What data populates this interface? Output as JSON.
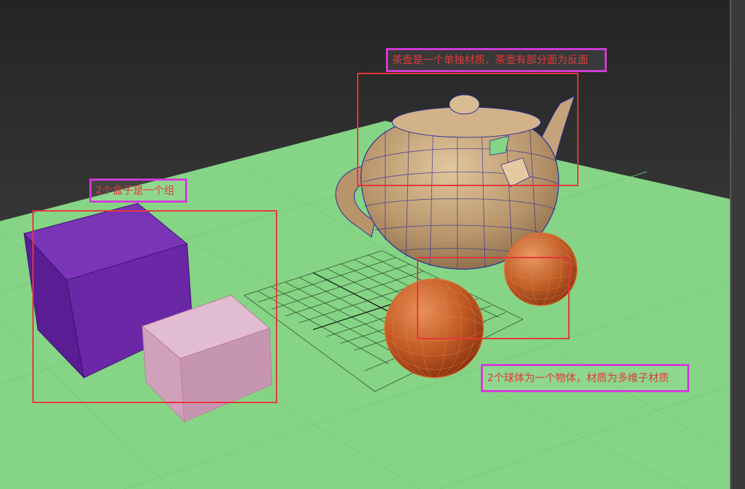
{
  "annotations": {
    "teapot": "茶壶是一个单独材质，茶壶有部分面为反面",
    "boxes": "2个盒子是一个组",
    "spheres": "2个球体为一个物体，材质为多维子材质"
  },
  "colors": {
    "viewport_bg_top": "#262626",
    "viewport_bg_bottom": "#4a4a4a",
    "ground": "#86d486",
    "annotation_border": "#d43ad8",
    "annotation_text": "#e03a3a",
    "selection_box": "#e8343a",
    "box_purple": "#6a27a6",
    "box_pink": "#d6a9c2",
    "sphere": "#c8642c",
    "teapot": "#c9a77a",
    "wire_blue": "#2a2a9a"
  }
}
